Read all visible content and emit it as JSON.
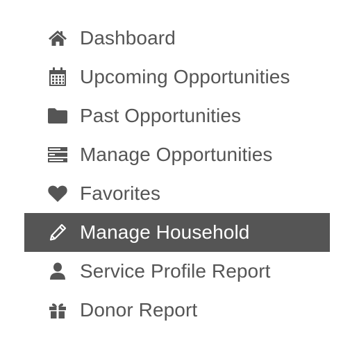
{
  "nav": {
    "items": [
      {
        "label": "Dashboard",
        "icon": "home-icon",
        "active": false
      },
      {
        "label": "Upcoming Opportunities",
        "icon": "calendar-icon",
        "active": false
      },
      {
        "label": "Past Opportunities",
        "icon": "folder-icon",
        "active": false
      },
      {
        "label": "Manage Opportunities",
        "icon": "tasks-icon",
        "active": false
      },
      {
        "label": "Favorites",
        "icon": "heart-icon",
        "active": false
      },
      {
        "label": "Manage Household",
        "icon": "pencil-icon",
        "active": true
      },
      {
        "label": "Service Profile Report",
        "icon": "user-icon",
        "active": false
      },
      {
        "label": "Donor Report",
        "icon": "gift-icon",
        "active": false
      }
    ]
  },
  "colors": {
    "text": "#555555",
    "active_background": "#555555",
    "active_text": "#ffffff",
    "background": "#ffffff"
  }
}
